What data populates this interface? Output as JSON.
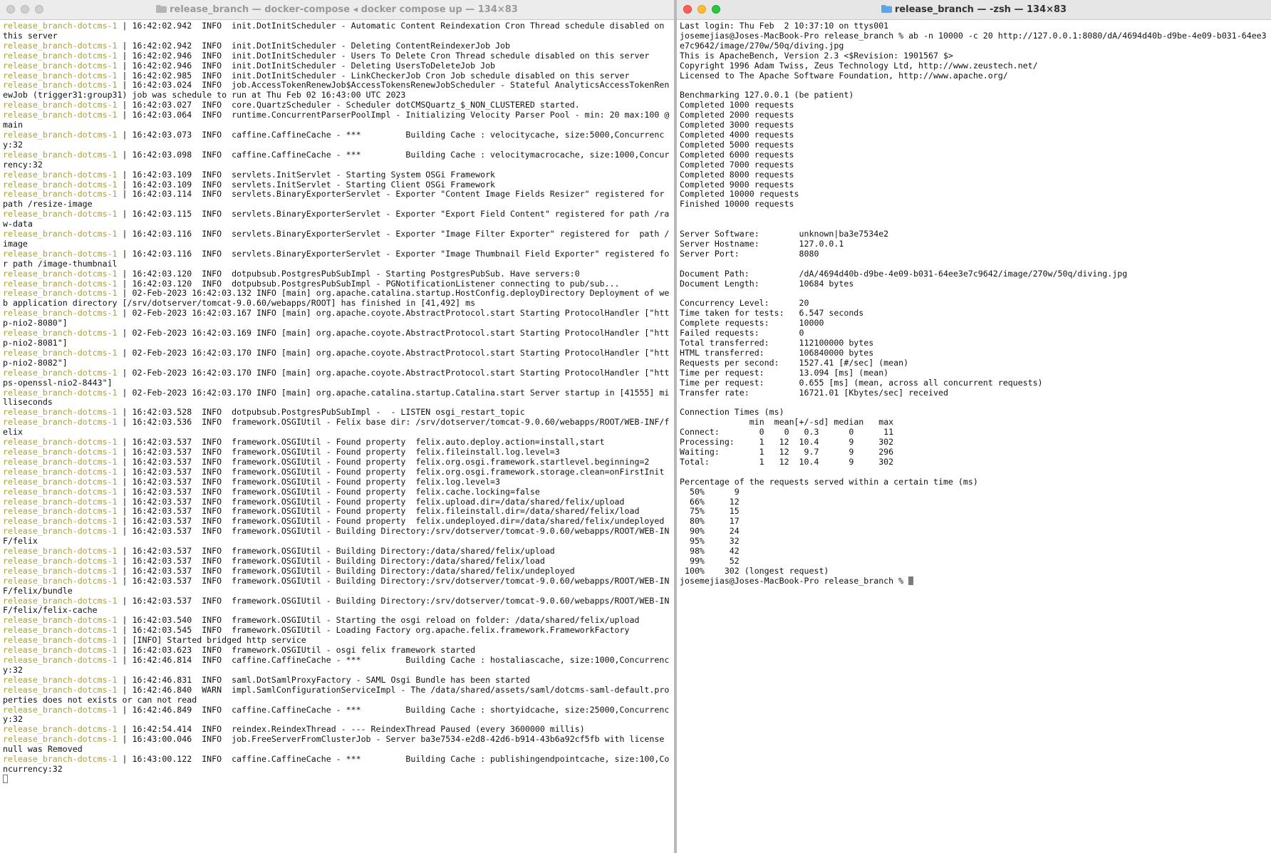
{
  "left_window": {
    "title": "release_branch — docker-compose ◂ docker compose up — 134×83",
    "service_prefix": "release_branch-dotcms-1",
    "log_lines": [
      " | 16:42:02.942  INFO  init.DotInitScheduler - Automatic Content Reindexation Cron Thread schedule disabled on this server",
      " | 16:42:02.942  INFO  init.DotInitScheduler - Deleting ContentReindexerJob Job",
      " | 16:42:02.946  INFO  init.DotInitScheduler - Users To Delete Cron Thread schedule disabled on this server",
      " | 16:42:02.946  INFO  init.DotInitScheduler - Deleting UsersToDeleteJob Job",
      " | 16:42:02.985  INFO  init.DotInitScheduler - LinkCheckerJob Cron Job schedule disabled on this server",
      " | 16:42:03.024  INFO  job.AccessTokenRenewJob$AccessTokensRenewJobScheduler - Stateful AnalyticsAccessTokenRenewJob (trigger31:group31) job was schedule to run at Thu Feb 02 16:43:00 UTC 2023",
      " | 16:42:03.027  INFO  core.QuartzScheduler - Scheduler dotCMSQuartz_$_NON_CLUSTERED started.",
      " | 16:42:03.064  INFO  runtime.ConcurrentParserPoolImpl - Initializing Velocity Parser Pool - min: 20 max:100 @ main",
      " | 16:42:03.073  INFO  caffine.CaffineCache - ***         Building Cache : velocitycache, size:5000,Concurrency:32",
      " | 16:42:03.098  INFO  caffine.CaffineCache - ***         Building Cache : velocitymacrocache, size:1000,Concurrency:32",
      " | 16:42:03.109  INFO  servlets.InitServlet - Starting System OSGi Framework",
      " | 16:42:03.109  INFO  servlets.InitServlet - Starting Client OSGi Framework",
      " | 16:42:03.114  INFO  servlets.BinaryExporterServlet - Exporter \"Content Image Fields Resizer\" registered for path /resize-image",
      " | 16:42:03.115  INFO  servlets.BinaryExporterServlet - Exporter \"Export Field Content\" registered for path /raw-data",
      " | 16:42:03.116  INFO  servlets.BinaryExporterServlet - Exporter \"Image Filter Exporter\" registered for  path /image",
      " | 16:42:03.116  INFO  servlets.BinaryExporterServlet - Exporter \"Image Thumbnail Field Exporter\" registered for path /image-thumbnail",
      " | 16:42:03.120  INFO  dotpubsub.PostgresPubSubImpl - Starting PostgresPubSub. Have servers:0",
      " | 16:42:03.120  INFO  dotpubsub.PostgresPubSubImpl - PGNotificationListener connecting to pub/sub...",
      " | 02-Feb-2023 16:42:03.132 INFO [main] org.apache.catalina.startup.HostConfig.deployDirectory Deployment of web application directory [/srv/dotserver/tomcat-9.0.60/webapps/ROOT] has finished in [41,492] ms",
      " | 02-Feb-2023 16:42:03.167 INFO [main] org.apache.coyote.AbstractProtocol.start Starting ProtocolHandler [\"http-nio2-8080\"]",
      " | 02-Feb-2023 16:42:03.169 INFO [main] org.apache.coyote.AbstractProtocol.start Starting ProtocolHandler [\"http-nio2-8081\"]",
      " | 02-Feb-2023 16:42:03.170 INFO [main] org.apache.coyote.AbstractProtocol.start Starting ProtocolHandler [\"http-nio2-8082\"]",
      " | 02-Feb-2023 16:42:03.170 INFO [main] org.apache.coyote.AbstractProtocol.start Starting ProtocolHandler [\"https-openssl-nio2-8443\"]",
      " | 02-Feb-2023 16:42:03.170 INFO [main] org.apache.catalina.startup.Catalina.start Server startup in [41555] milliseconds",
      " | 16:42:03.528  INFO  dotpubsub.PostgresPubSubImpl -  - LISTEN osgi_restart_topic",
      " | 16:42:03.536  INFO  framework.OSGIUtil - Felix base dir: /srv/dotserver/tomcat-9.0.60/webapps/ROOT/WEB-INF/felix",
      " | 16:42:03.537  INFO  framework.OSGIUtil - Found property  felix.auto.deploy.action=install,start",
      " | 16:42:03.537  INFO  framework.OSGIUtil - Found property  felix.fileinstall.log.level=3",
      " | 16:42:03.537  INFO  framework.OSGIUtil - Found property  felix.org.osgi.framework.startlevel.beginning=2",
      " | 16:42:03.537  INFO  framework.OSGIUtil - Found property  felix.org.osgi.framework.storage.clean=onFirstInit",
      " | 16:42:03.537  INFO  framework.OSGIUtil - Found property  felix.log.level=3",
      " | 16:42:03.537  INFO  framework.OSGIUtil - Found property  felix.cache.locking=false",
      " | 16:42:03.537  INFO  framework.OSGIUtil - Found property  felix.upload.dir=/data/shared/felix/upload",
      " | 16:42:03.537  INFO  framework.OSGIUtil - Found property  felix.fileinstall.dir=/data/shared/felix/load",
      " | 16:42:03.537  INFO  framework.OSGIUtil - Found property  felix.undeployed.dir=/data/shared/felix/undeployed",
      " | 16:42:03.537  INFO  framework.OSGIUtil - Building Directory:/srv/dotserver/tomcat-9.0.60/webapps/ROOT/WEB-INF/felix",
      " | 16:42:03.537  INFO  framework.OSGIUtil - Building Directory:/data/shared/felix/upload",
      " | 16:42:03.537  INFO  framework.OSGIUtil - Building Directory:/data/shared/felix/load",
      " | 16:42:03.537  INFO  framework.OSGIUtil - Building Directory:/data/shared/felix/undeployed",
      " | 16:42:03.537  INFO  framework.OSGIUtil - Building Directory:/srv/dotserver/tomcat-9.0.60/webapps/ROOT/WEB-INF/felix/bundle",
      " | 16:42:03.537  INFO  framework.OSGIUtil - Building Directory:/srv/dotserver/tomcat-9.0.60/webapps/ROOT/WEB-INF/felix/felix-cache",
      " | 16:42:03.540  INFO  framework.OSGIUtil - Starting the osgi reload on folder: /data/shared/felix/upload",
      " | 16:42:03.545  INFO  framework.OSGIUtil - Loading Factory org.apache.felix.framework.FrameworkFactory",
      " | [INFO] Started bridged http service",
      " | 16:42:03.623  INFO  framework.OSGIUtil - osgi felix framework started",
      " | 16:42:46.814  INFO  caffine.CaffineCache - ***         Building Cache : hostaliascache, size:1000,Concurrency:32",
      " | 16:42:46.831  INFO  saml.DotSamlProxyFactory - SAML Osgi Bundle has been started",
      " | 16:42:46.840  WARN  impl.SamlConfigurationServiceImpl - The /data/shared/assets/saml/dotcms-saml-default.properties does not exists or can not read",
      " | 16:42:46.849  INFO  caffine.CaffineCache - ***         Building Cache : shortyidcache, size:25000,Concurrency:32",
      " | 16:42:54.414  INFO  reindex.ReindexThread - --- ReindexThread Paused (every 3600000 millis)",
      " | 16:43:00.046  INFO  job.FreeServerFromClusterJob - Server ba3e7534-e2d8-42d6-b914-43b6a92cf5fb with license null was Removed",
      " | 16:43:00.122  INFO  caffine.CaffineCache - ***         Building Cache : publishingendpointcache, size:100,Concurrency:32"
    ]
  },
  "right_window": {
    "title": "release_branch — -zsh — 134×83",
    "lines": [
      "Last login: Thu Feb  2 10:37:10 on ttys001",
      "josemejias@Joses-MacBook-Pro release_branch % ab -n 10000 -c 20 http://127.0.0.1:8080/dA/4694d40b-d9be-4e09-b031-64ee3e7c9642/image/270w/50q/diving.jpg",
      "This is ApacheBench, Version 2.3 <$Revision: 1901567 $>",
      "Copyright 1996 Adam Twiss, Zeus Technology Ltd, http://www.zeustech.net/",
      "Licensed to The Apache Software Foundation, http://www.apache.org/",
      "",
      "Benchmarking 127.0.0.1 (be patient)",
      "Completed 1000 requests",
      "Completed 2000 requests",
      "Completed 3000 requests",
      "Completed 4000 requests",
      "Completed 5000 requests",
      "Completed 6000 requests",
      "Completed 7000 requests",
      "Completed 8000 requests",
      "Completed 9000 requests",
      "Completed 10000 requests",
      "Finished 10000 requests",
      "",
      "",
      "Server Software:        unknown|ba3e7534e2",
      "Server Hostname:        127.0.0.1",
      "Server Port:            8080",
      "",
      "Document Path:          /dA/4694d40b-d9be-4e09-b031-64ee3e7c9642/image/270w/50q/diving.jpg",
      "Document Length:        10684 bytes",
      "",
      "Concurrency Level:      20",
      "Time taken for tests:   6.547 seconds",
      "Complete requests:      10000",
      "Failed requests:        0",
      "Total transferred:      112100000 bytes",
      "HTML transferred:       106840000 bytes",
      "Requests per second:    1527.41 [#/sec] (mean)",
      "Time per request:       13.094 [ms] (mean)",
      "Time per request:       0.655 [ms] (mean, across all concurrent requests)",
      "Transfer rate:          16721.01 [Kbytes/sec] received",
      "",
      "Connection Times (ms)",
      "              min  mean[+/-sd] median   max",
      "Connect:        0    0   0.3      0      11",
      "Processing:     1   12  10.4      9     302",
      "Waiting:        1   12   9.7      9     296",
      "Total:          1   12  10.4      9     302",
      "",
      "Percentage of the requests served within a certain time (ms)",
      "  50%      9",
      "  66%     12",
      "  75%     15",
      "  80%     17",
      "  90%     24",
      "  95%     32",
      "  98%     42",
      "  99%     52",
      " 100%    302 (longest request)"
    ],
    "prompt": "josemejias@Joses-MacBook-Pro release_branch % "
  },
  "colors": {
    "service_prefix": "#aba13a",
    "close": "#ff5f57",
    "minimize": "#febc2e",
    "zoom": "#28c840",
    "folder_active": "#5aa6e8"
  },
  "icons": {
    "title_folder": "folder-icon",
    "traffic_lights": [
      "close-button",
      "minimize-button",
      "zoom-button"
    ]
  }
}
